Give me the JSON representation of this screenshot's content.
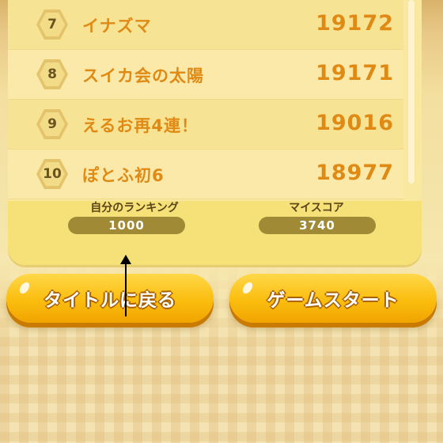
{
  "ranking": [
    {
      "rank": "7",
      "name": "イナズマ",
      "score": "19172"
    },
    {
      "rank": "8",
      "name": "スイカ会の太陽",
      "score": "19171"
    },
    {
      "rank": "9",
      "name": "えるお再4連！",
      "score": "19016"
    },
    {
      "rank": "10",
      "name": "ぽとふ初6",
      "score": "18977"
    }
  ],
  "stats": {
    "my_rank_label": "自分のランキング",
    "my_rank_value": "1000",
    "my_score_label": "マイスコア",
    "my_score_value": "3740"
  },
  "buttons": {
    "title_label": "タイトルに戻る",
    "start_label": "ゲームスタート"
  },
  "colors": {
    "panel": "#f8e8a0",
    "score_text": "#e08a16",
    "button_fill": "#fbbd0e",
    "stat_pill": "#a08a35"
  },
  "icons": {
    "rank_badge": "hexagon-rank-badge-icon",
    "annotation": "up-arrow-annotation-icon"
  }
}
